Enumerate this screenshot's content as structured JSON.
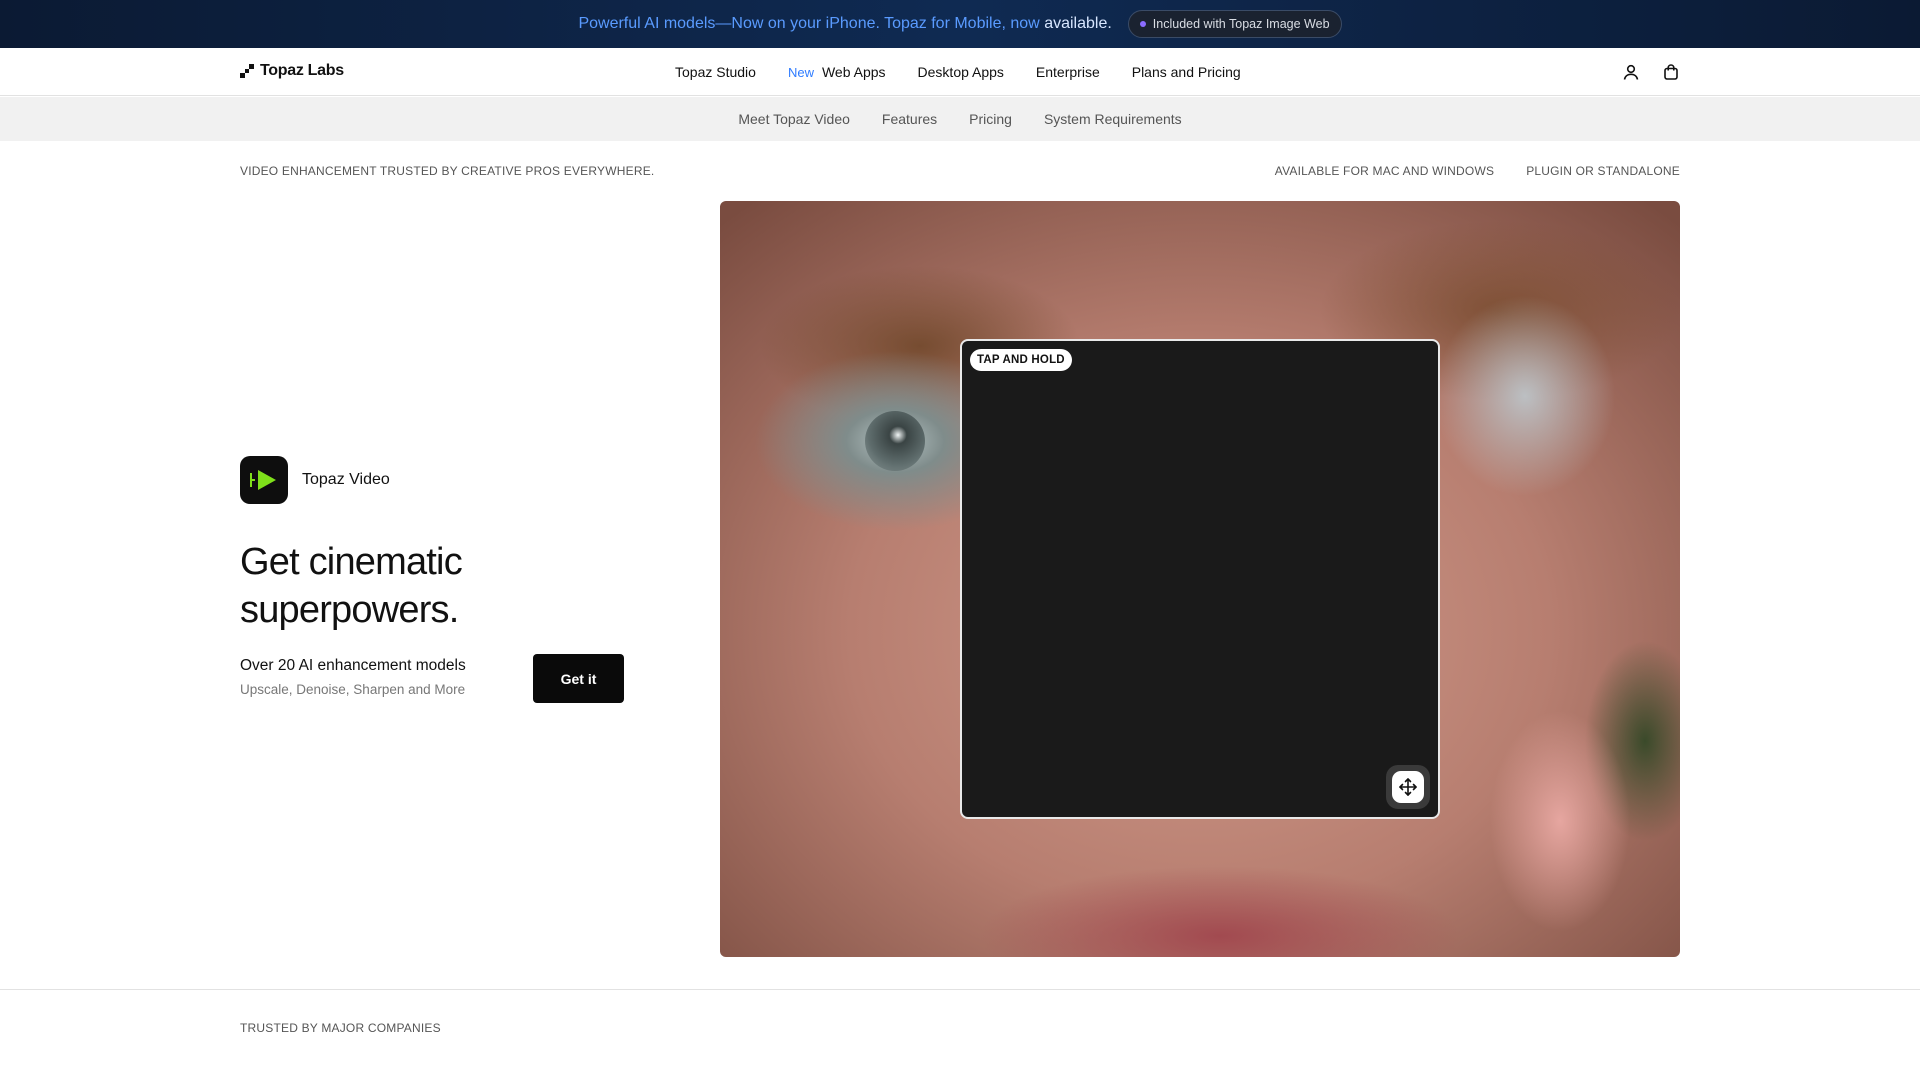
{
  "announcement": {
    "highlight": "Powerful AI models—Now on your iPhone. Topaz for Mobile, now",
    "plain": "available.",
    "pill_label": "Included with Topaz Image Web",
    "pill_dot_color": "#8a6cff"
  },
  "nav": {
    "logo_text": "Topaz Labs",
    "links": [
      {
        "label": "Topaz Studio"
      },
      {
        "label": "Web Apps",
        "badge": "New"
      },
      {
        "label": "Desktop Apps"
      },
      {
        "label": "Enterprise"
      },
      {
        "label": "Plans and Pricing"
      }
    ],
    "icons": [
      "user-icon",
      "shopping-bag-icon"
    ]
  },
  "subnav": {
    "links": [
      "Meet Topaz Video",
      "Features",
      "Pricing",
      "System Requirements"
    ]
  },
  "info": {
    "left": "VIDEO ENHANCEMENT TRUSTED BY CREATIVE PROS EVERYWHERE.",
    "right_1": "AVAILABLE FOR MAC AND WINDOWS",
    "right_2": "PLUGIN OR STANDALONE"
  },
  "hero": {
    "product_name": "Topaz Video",
    "product_icon": "play-icon",
    "product_icon_color": "#7ee01a",
    "headline": "Get cinematic superpowers.",
    "features_title": "Over 20 AI enhancement models",
    "features_sub": "Upscale, Denoise, Sharpen and More",
    "cta_label": "Get it",
    "compare_label": "TAP AND HOLD",
    "compare_handle_icon": "move-icon"
  },
  "footer": {
    "trusted_label": "TRUSTED BY MAJOR COMPANIES"
  },
  "colors": {
    "accent_blue": "#2f7cff",
    "announcement_bg": "#0f2a52",
    "cta_bg": "#0a0a0a"
  }
}
